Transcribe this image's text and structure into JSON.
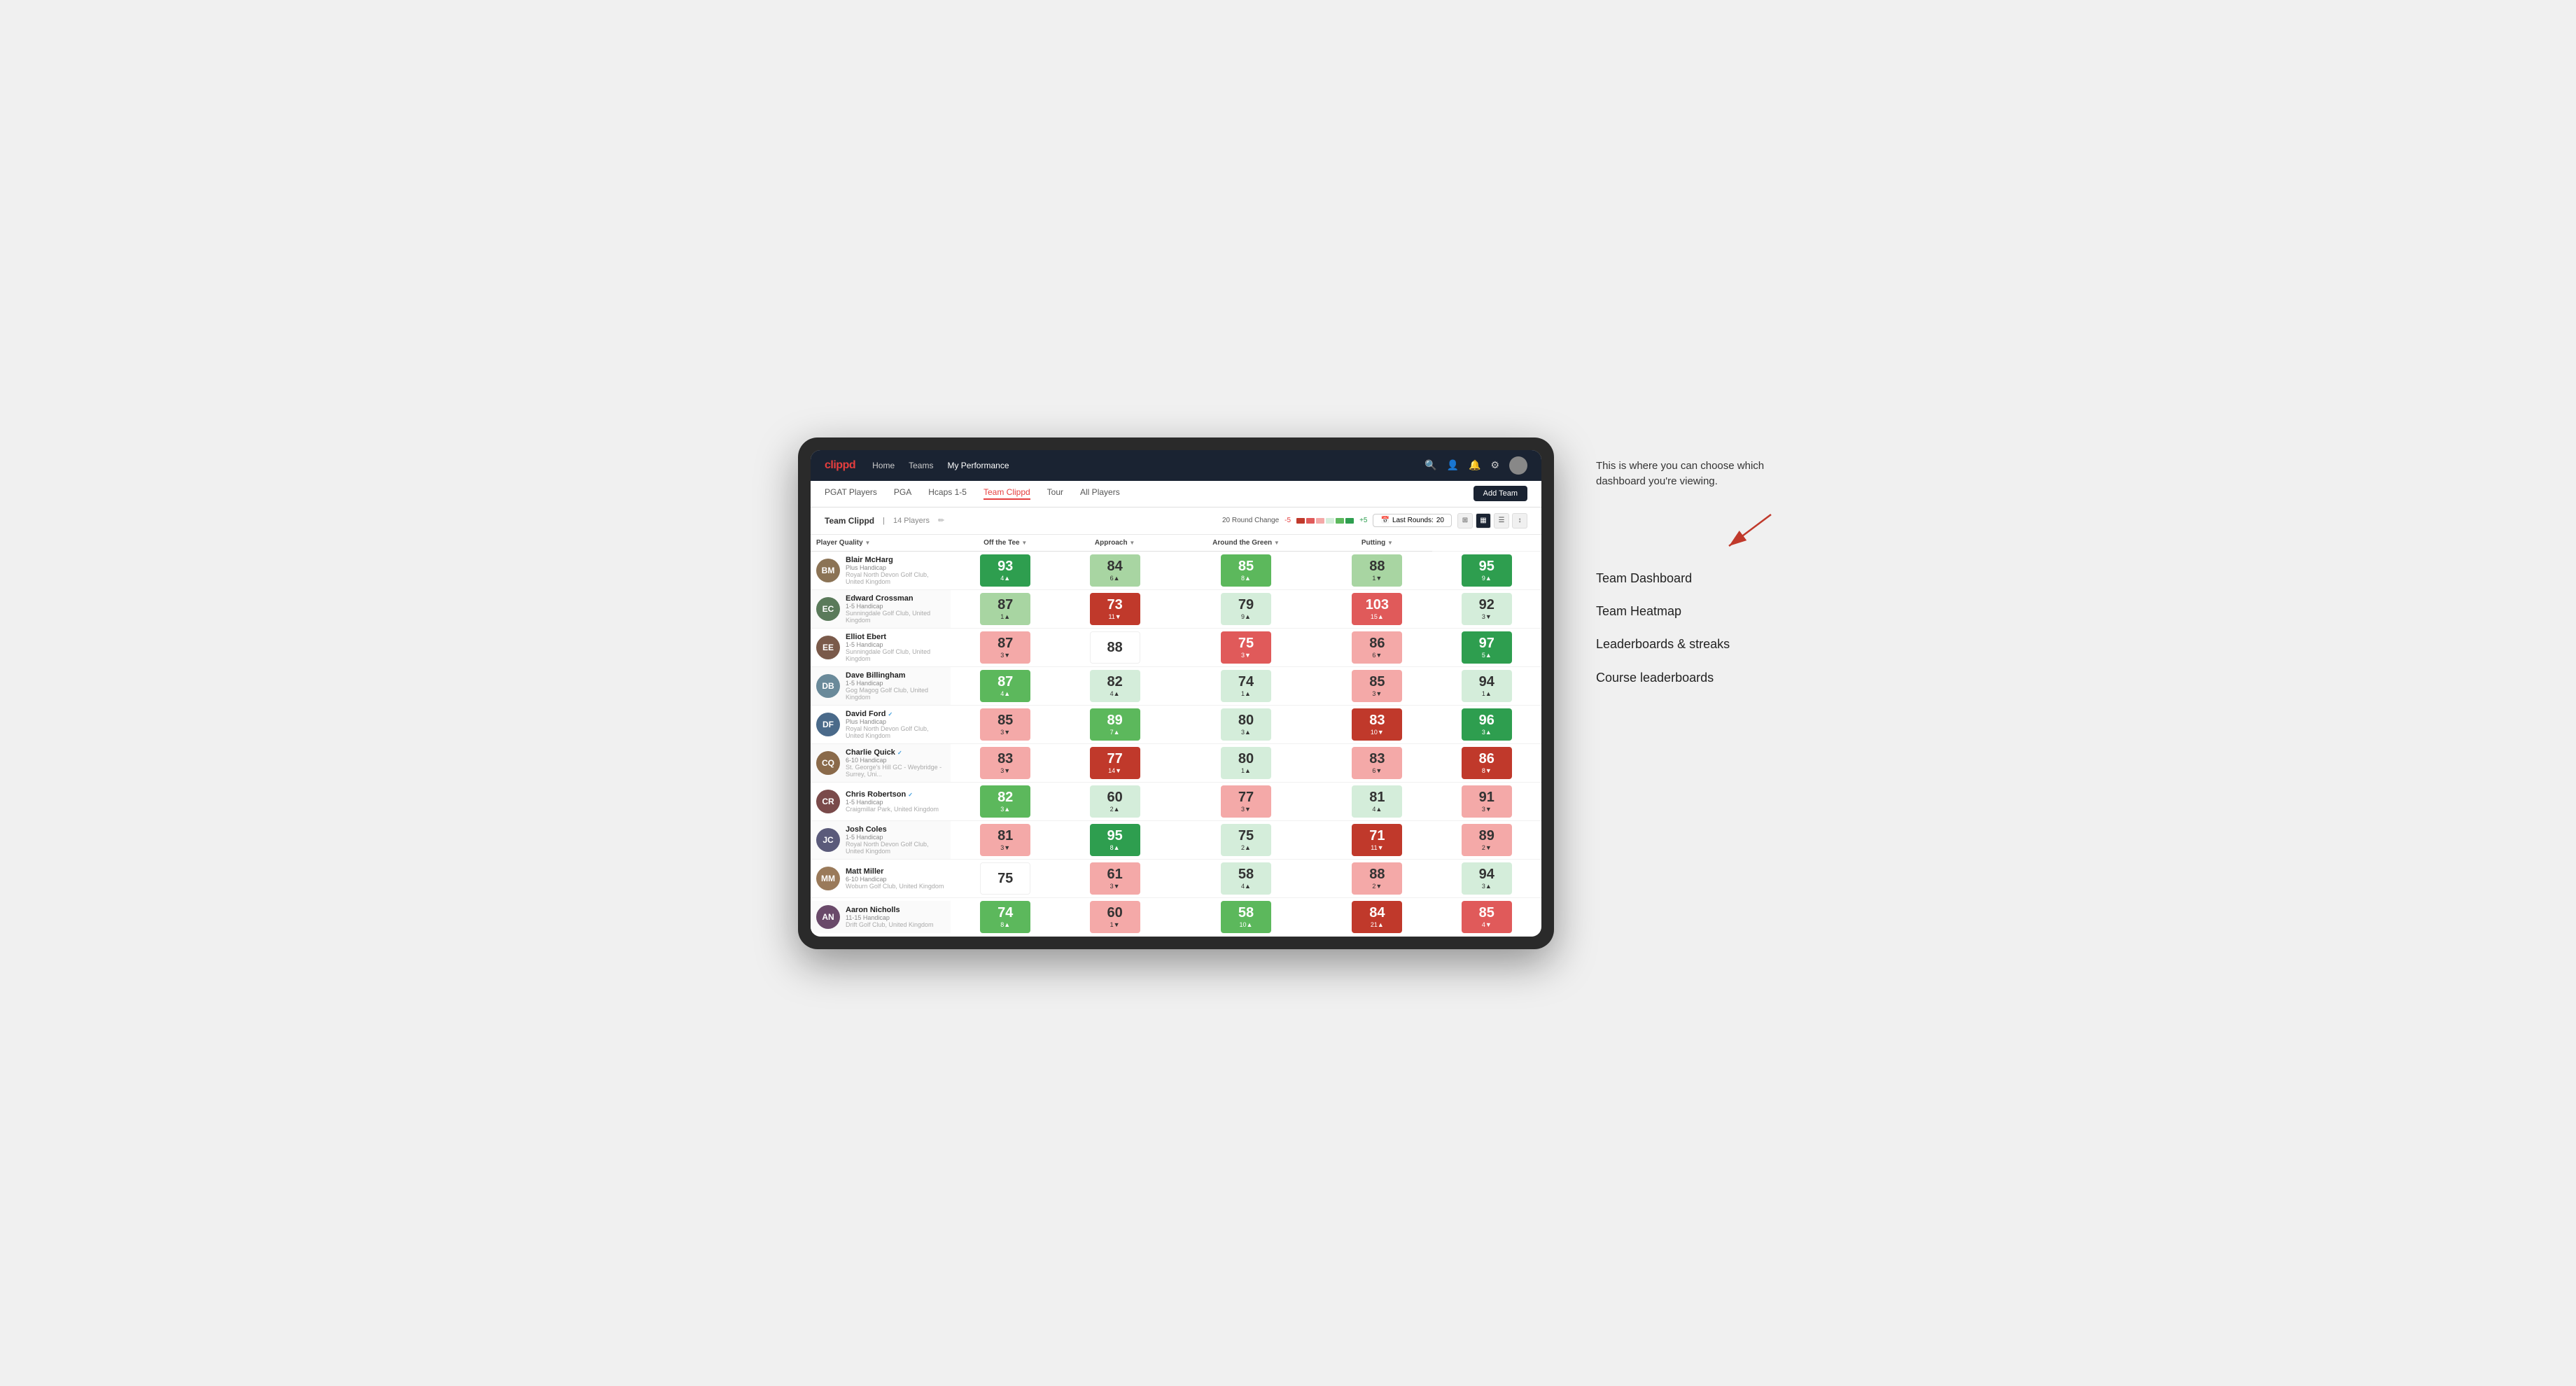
{
  "annotation": {
    "callout": "This is where you can choose which dashboard you're viewing.",
    "items": [
      "Team Dashboard",
      "Team Heatmap",
      "Leaderboards & streaks",
      "Course leaderboards"
    ]
  },
  "nav": {
    "logo": "clippd",
    "links": [
      "Home",
      "Teams",
      "My Performance"
    ],
    "active_link": "My Performance"
  },
  "sub_nav": {
    "links": [
      "PGAT Players",
      "PGA",
      "Hcaps 1-5",
      "Team Clippd",
      "Tour",
      "All Players"
    ],
    "active": "Team Clippd",
    "add_team": "Add Team"
  },
  "team_header": {
    "title": "Team Clippd",
    "separator": "|",
    "count": "14 Players",
    "round_change_label": "20 Round Change",
    "minus_label": "-5",
    "plus_label": "+5",
    "last_rounds_label": "Last Rounds:",
    "last_rounds_value": "20"
  },
  "columns": {
    "player": "Player Quality",
    "off_tee": "Off the Tee",
    "approach": "Approach",
    "around_green": "Around the Green",
    "putting": "Putting"
  },
  "players": [
    {
      "name": "Blair McHarg",
      "handicap": "Plus Handicap",
      "club": "Royal North Devon Golf Club, United Kingdom",
      "avatar_color": "#8B7355",
      "initials": "BM",
      "scores": {
        "quality": {
          "value": "93",
          "change": "4",
          "dir": "up",
          "color": "green-dark"
        },
        "off_tee": {
          "value": "84",
          "change": "6",
          "dir": "up",
          "color": "green-light"
        },
        "approach": {
          "value": "85",
          "change": "8",
          "dir": "up",
          "color": "green-mid"
        },
        "around_green": {
          "value": "88",
          "change": "1",
          "dir": "down",
          "color": "green-light"
        },
        "putting": {
          "value": "95",
          "change": "9",
          "dir": "up",
          "color": "green-dark"
        }
      }
    },
    {
      "name": "Edward Crossman",
      "handicap": "1-5 Handicap",
      "club": "Sunningdale Golf Club, United Kingdom",
      "avatar_color": "#5a7a5a",
      "initials": "EC",
      "scores": {
        "quality": {
          "value": "87",
          "change": "1",
          "dir": "up",
          "color": "green-light"
        },
        "off_tee": {
          "value": "73",
          "change": "11",
          "dir": "down",
          "color": "red-dark"
        },
        "approach": {
          "value": "79",
          "change": "9",
          "dir": "up",
          "color": "green-pale"
        },
        "around_green": {
          "value": "103",
          "change": "15",
          "dir": "up",
          "color": "red-mid"
        },
        "putting": {
          "value": "92",
          "change": "3",
          "dir": "down",
          "color": "green-pale"
        }
      }
    },
    {
      "name": "Elliot Ebert",
      "handicap": "1-5 Handicap",
      "club": "Sunningdale Golf Club, United Kingdom",
      "avatar_color": "#7a5a4a",
      "initials": "EE",
      "scores": {
        "quality": {
          "value": "87",
          "change": "3",
          "dir": "down",
          "color": "red-light"
        },
        "off_tee": {
          "value": "88",
          "change": "",
          "dir": "",
          "color": "neutral"
        },
        "approach": {
          "value": "75",
          "change": "3",
          "dir": "down",
          "color": "red-mid"
        },
        "around_green": {
          "value": "86",
          "change": "6",
          "dir": "down",
          "color": "red-light"
        },
        "putting": {
          "value": "97",
          "change": "5",
          "dir": "up",
          "color": "green-dark"
        }
      }
    },
    {
      "name": "Dave Billingham",
      "handicap": "1-5 Handicap",
      "club": "Gog Magog Golf Club, United Kingdom",
      "avatar_color": "#6a8a9a",
      "initials": "DB",
      "scores": {
        "quality": {
          "value": "87",
          "change": "4",
          "dir": "up",
          "color": "green-mid"
        },
        "off_tee": {
          "value": "82",
          "change": "4",
          "dir": "up",
          "color": "green-pale"
        },
        "approach": {
          "value": "74",
          "change": "1",
          "dir": "up",
          "color": "green-pale"
        },
        "around_green": {
          "value": "85",
          "change": "3",
          "dir": "down",
          "color": "red-light"
        },
        "putting": {
          "value": "94",
          "change": "1",
          "dir": "up",
          "color": "green-pale"
        }
      }
    },
    {
      "name": "David Ford",
      "handicap": "Plus Handicap",
      "club": "Royal North Devon Golf Club, United Kingdom",
      "avatar_color": "#4a6a8a",
      "initials": "DF",
      "verified": true,
      "scores": {
        "quality": {
          "value": "85",
          "change": "3",
          "dir": "down",
          "color": "red-light"
        },
        "off_tee": {
          "value": "89",
          "change": "7",
          "dir": "up",
          "color": "green-mid"
        },
        "approach": {
          "value": "80",
          "change": "3",
          "dir": "up",
          "color": "green-pale"
        },
        "around_green": {
          "value": "83",
          "change": "10",
          "dir": "down",
          "color": "red-dark"
        },
        "putting": {
          "value": "96",
          "change": "3",
          "dir": "up",
          "color": "green-dark"
        }
      }
    },
    {
      "name": "Charlie Quick",
      "handicap": "6-10 Handicap",
      "club": "St. George's Hill GC - Weybridge - Surrey, Uni...",
      "avatar_color": "#8a6a4a",
      "initials": "CQ",
      "verified": true,
      "scores": {
        "quality": {
          "value": "83",
          "change": "3",
          "dir": "down",
          "color": "red-light"
        },
        "off_tee": {
          "value": "77",
          "change": "14",
          "dir": "down",
          "color": "red-dark"
        },
        "approach": {
          "value": "80",
          "change": "1",
          "dir": "up",
          "color": "green-pale"
        },
        "around_green": {
          "value": "83",
          "change": "6",
          "dir": "down",
          "color": "red-light"
        },
        "putting": {
          "value": "86",
          "change": "8",
          "dir": "down",
          "color": "red-dark"
        }
      }
    },
    {
      "name": "Chris Robertson",
      "handicap": "1-5 Handicap",
      "club": "Craigmillar Park, United Kingdom",
      "avatar_color": "#7a4a4a",
      "initials": "CR",
      "verified": true,
      "scores": {
        "quality": {
          "value": "82",
          "change": "3",
          "dir": "up",
          "color": "green-mid"
        },
        "off_tee": {
          "value": "60",
          "change": "2",
          "dir": "up",
          "color": "green-pale"
        },
        "approach": {
          "value": "77",
          "change": "3",
          "dir": "down",
          "color": "red-light"
        },
        "around_green": {
          "value": "81",
          "change": "4",
          "dir": "up",
          "color": "green-pale"
        },
        "putting": {
          "value": "91",
          "change": "3",
          "dir": "down",
          "color": "red-light"
        }
      }
    },
    {
      "name": "Josh Coles",
      "handicap": "1-5 Handicap",
      "club": "Royal North Devon Golf Club, United Kingdom",
      "avatar_color": "#5a5a7a",
      "initials": "JC",
      "scores": {
        "quality": {
          "value": "81",
          "change": "3",
          "dir": "down",
          "color": "red-light"
        },
        "off_tee": {
          "value": "95",
          "change": "8",
          "dir": "up",
          "color": "green-dark"
        },
        "approach": {
          "value": "75",
          "change": "2",
          "dir": "up",
          "color": "green-pale"
        },
        "around_green": {
          "value": "71",
          "change": "11",
          "dir": "down",
          "color": "red-dark"
        },
        "putting": {
          "value": "89",
          "change": "2",
          "dir": "down",
          "color": "red-light"
        }
      }
    },
    {
      "name": "Matt Miller",
      "handicap": "6-10 Handicap",
      "club": "Woburn Golf Club, United Kingdom",
      "avatar_color": "#9a7a5a",
      "initials": "MM",
      "scores": {
        "quality": {
          "value": "75",
          "change": "",
          "dir": "",
          "color": "neutral"
        },
        "off_tee": {
          "value": "61",
          "change": "3",
          "dir": "down",
          "color": "red-light"
        },
        "approach": {
          "value": "58",
          "change": "4",
          "dir": "up",
          "color": "green-pale"
        },
        "around_green": {
          "value": "88",
          "change": "2",
          "dir": "down",
          "color": "red-light"
        },
        "putting": {
          "value": "94",
          "change": "3",
          "dir": "up",
          "color": "green-pale"
        }
      }
    },
    {
      "name": "Aaron Nicholls",
      "handicap": "11-15 Handicap",
      "club": "Drift Golf Club, United Kingdom",
      "avatar_color": "#6a4a6a",
      "initials": "AN",
      "scores": {
        "quality": {
          "value": "74",
          "change": "8",
          "dir": "up",
          "color": "green-mid"
        },
        "off_tee": {
          "value": "60",
          "change": "1",
          "dir": "down",
          "color": "red-light"
        },
        "approach": {
          "value": "58",
          "change": "10",
          "dir": "up",
          "color": "green-mid"
        },
        "around_green": {
          "value": "84",
          "change": "21",
          "dir": "up",
          "color": "red-dark"
        },
        "putting": {
          "value": "85",
          "change": "4",
          "dir": "down",
          "color": "red-mid"
        }
      }
    }
  ]
}
